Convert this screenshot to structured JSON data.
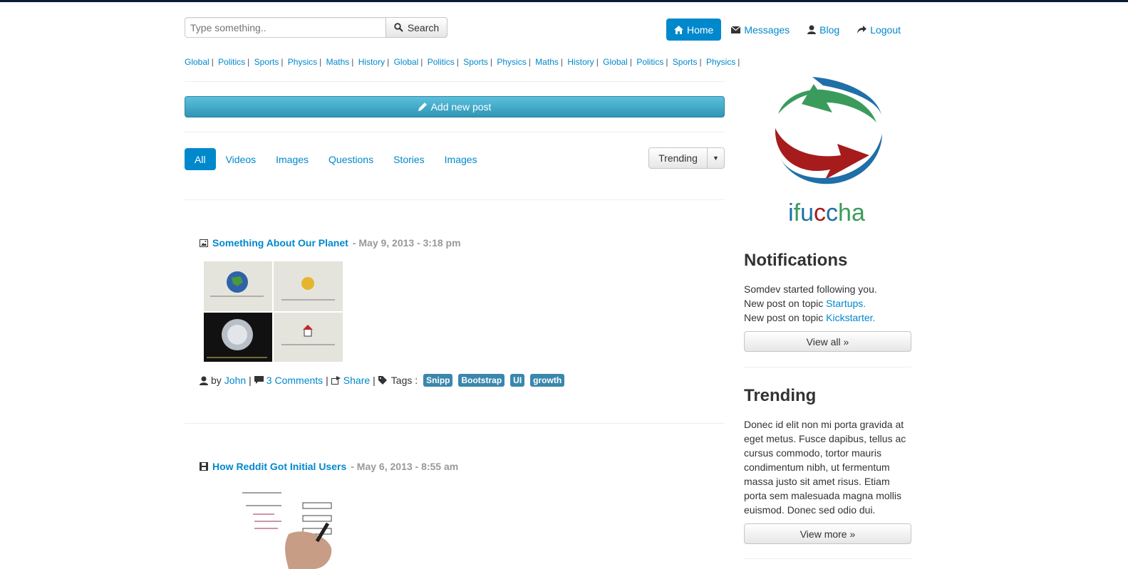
{
  "search": {
    "placeholder": "Type something..",
    "button_label": "Search"
  },
  "nav": [
    {
      "label": "Home",
      "icon": "home-icon",
      "active": true
    },
    {
      "label": "Messages",
      "icon": "envelope-icon"
    },
    {
      "label": "Blog",
      "icon": "user-icon"
    },
    {
      "label": "Logout",
      "icon": "share-arrow-icon"
    }
  ],
  "topics": [
    "Global",
    "Politics",
    "Sports",
    "Physics",
    "Maths",
    "History",
    "Global",
    "Politics",
    "Sports",
    "Physics",
    "Maths",
    "History",
    "Global",
    "Politics",
    "Sports",
    "Physics"
  ],
  "add_post_label": "Add new post",
  "filter_tabs": [
    "All",
    "Videos",
    "Images",
    "Questions",
    "Stories",
    "Images"
  ],
  "sort": {
    "selected": "Trending"
  },
  "posts": [
    {
      "icon": "picture-icon",
      "title": "Something About Our Planet",
      "date": "- May 9, 2013 - 3:18 pm",
      "by_label": "by",
      "author": "John",
      "comments": "3 Comments",
      "share": "Share",
      "tags_label": "Tags :",
      "tags": [
        "Snipp",
        "Bootstrap",
        "UI",
        "growth"
      ]
    },
    {
      "icon": "film-icon",
      "title": "How Reddit Got Initial Users",
      "date": "- May 6, 2013 - 8:55 am"
    }
  ],
  "logo_text": "ifuccha",
  "notifications": {
    "title": "Notifications",
    "line1": "Somdev started following you.",
    "line2_prefix": "New post on topic ",
    "line2_link": "Startups.",
    "line3_prefix": "New post on topic ",
    "line3_link": "Kickstarter.",
    "button": "View all »"
  },
  "trending": {
    "title": "Trending",
    "text": "Donec id elit non mi porta gravida at eget metus. Fusce dapibus, tellus ac cursus commodo, tortor mauris condimentum nibh, ut fermentum massa justo sit amet risus. Etiam porta sem malesuada magna mollis euismod. Donec sed odio dui.",
    "button": "View more »"
  },
  "colors": {
    "link": "#0088cc",
    "info": "#5bc0de",
    "tag": "#3a87ad",
    "logo_red": "#a61c1c",
    "logo_green": "#3a9b5c",
    "logo_blue": "#1f6fa8"
  }
}
